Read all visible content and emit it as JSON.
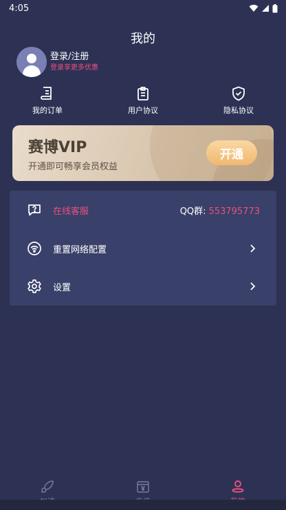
{
  "status_bar": {
    "time": "4:05"
  },
  "header": {
    "title": "我的"
  },
  "user": {
    "login_label": "登录/注册",
    "login_subtitle": "登录享更多优惠"
  },
  "shortcuts": [
    {
      "label": "我的订单",
      "icon": "order-icon"
    },
    {
      "label": "用户协议",
      "icon": "clipboard-icon"
    },
    {
      "label": "隐私协议",
      "icon": "shield-check-icon"
    }
  ],
  "vip": {
    "title": "赛博VIP",
    "subtitle": "开通即可畅享会员权益",
    "button_label": "开通"
  },
  "menu": {
    "support": {
      "label": "在线客服",
      "qq_label": "QQ群:",
      "qq_number": "553795773"
    },
    "reset_network": {
      "label": "重置网络配置"
    },
    "settings": {
      "label": "设置"
    }
  },
  "bottom_nav": [
    {
      "label": "加速",
      "icon": "rocket-icon",
      "active": false
    },
    {
      "label": "充值",
      "icon": "recharge-icon",
      "active": false
    },
    {
      "label": "我的",
      "icon": "profile-icon",
      "active": true
    }
  ],
  "colors": {
    "background": "#2d3254",
    "card": "#394069",
    "accent_pink": "#e8507e",
    "vip_gold": "#f0b870"
  }
}
